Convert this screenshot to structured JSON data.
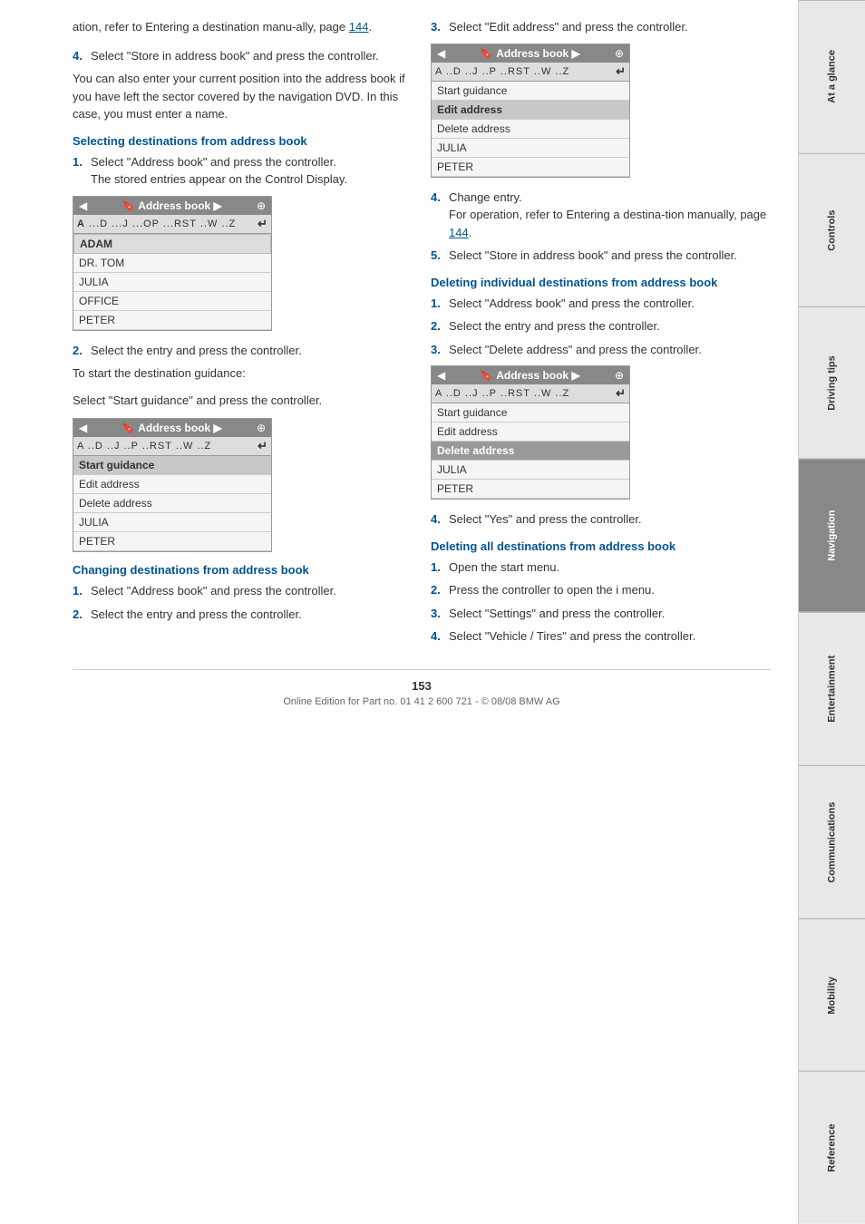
{
  "sidebar": {
    "tabs": [
      {
        "label": "At a glance",
        "active": false
      },
      {
        "label": "Controls",
        "active": false
      },
      {
        "label": "Driving tips",
        "active": false
      },
      {
        "label": "Navigation",
        "active": true
      },
      {
        "label": "Entertainment",
        "active": false
      },
      {
        "label": "Communications",
        "active": false
      },
      {
        "label": "Mobility",
        "active": false
      },
      {
        "label": "Reference",
        "active": false
      }
    ]
  },
  "intro": {
    "text1": "ation, refer to Entering a destination manu-ally, page ",
    "page1": "144",
    "text1b": ".",
    "item4": "Select \"Store in address book\" and press the controller.",
    "body1": "You can also enter your current position into the address book if you have left the sector covered by the navigation DVD. In this case, you must enter a name."
  },
  "section_selecting": {
    "heading": "Selecting destinations from address book",
    "item1": "Select \"Address book\" and press the controller.",
    "item1b": "The stored entries appear on the Control Display.",
    "item2": "Select the entry and press the controller.",
    "item3": "To start the destination guidance:",
    "item3b": "Select \"Start guidance\" and press the controller."
  },
  "section_changing": {
    "heading": "Changing destinations from address book",
    "item1": "Select \"Address book\" and press the controller.",
    "item2": "Select the entry and press the controller."
  },
  "section_right_change": {
    "item3": "Select \"Edit address\" and press the controller.",
    "item4": "Change entry.",
    "item4b": "For operation, refer to Entering a destina-tion manually, page ",
    "page4": "144",
    "item4c": ".",
    "item5": "Select \"Store in address book\" and press the controller."
  },
  "section_deleting_individual": {
    "heading": "Deleting individual destinations from address book",
    "item1": "Select \"Address book\" and press the controller.",
    "item2": "Select the entry and press the controller.",
    "item3": "Select \"Delete address\" and press the controller.",
    "item4": "Select \"Yes\" and press the controller."
  },
  "section_deleting_all": {
    "heading": "Deleting all destinations from address book",
    "item1": "Open the start menu.",
    "item2": "Press the controller to open the i menu.",
    "item3": "Select \"Settings\" and press the controller.",
    "item4": "Select \"Vehicle / Tires\" and press the controller."
  },
  "widgets": {
    "ab1": {
      "title": "Address book",
      "alpha": "A ...D ...J ...OP ...RST ..W ..Z",
      "items": [
        "ADAM",
        "DR. TOM",
        "JULIA",
        "OFFICE",
        "PETER"
      ],
      "first_alpha": "A"
    },
    "ab2": {
      "title": "Address book",
      "alpha": "A ..D ..J ..P ..RST ..W ..Z",
      "items_left": [
        "Start guidance",
        "Edit address",
        "Delete address",
        "JULIA",
        "PETER"
      ],
      "selected": "Start guidance"
    },
    "ab3": {
      "title": "Address book",
      "alpha": "A ..D ..J ..P ..RST ..W ..Z",
      "items_right": [
        "Start guidance",
        "Edit address",
        "Delete address",
        "JULIA",
        "PETER"
      ],
      "selected": "Edit address"
    },
    "ab4": {
      "title": "Address book",
      "alpha": "A ..D ..J ..P ..RST ..W ..Z",
      "items_del": [
        "Start guidance",
        "Edit address",
        "Delete address",
        "JULIA",
        "PETER"
      ],
      "selected": "Delete address"
    }
  },
  "footer": {
    "page_number": "153",
    "text": "Online Edition for Part no. 01 41 2 600 721 - © 08/08 BMW AG"
  }
}
